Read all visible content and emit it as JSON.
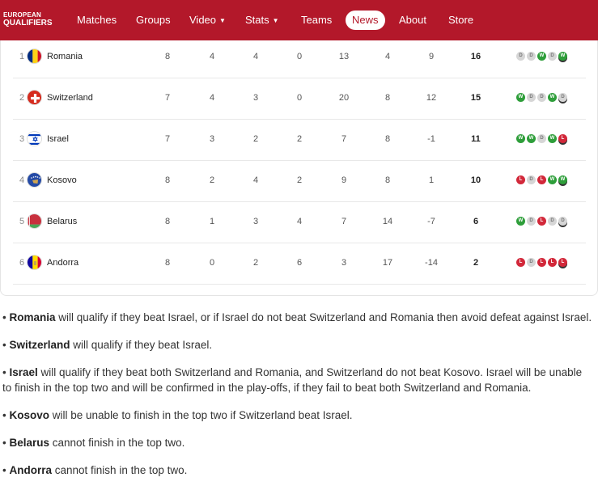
{
  "nav": {
    "logo_line1": "EUROPEAN",
    "logo_line2": "QUALIFIERS",
    "items": [
      {
        "label": "Matches"
      },
      {
        "label": "Groups"
      },
      {
        "label": "Video",
        "caret": "▼"
      },
      {
        "label": "Stats",
        "caret": "▼"
      },
      {
        "label": "Teams"
      },
      {
        "label": "News",
        "active": true
      },
      {
        "label": "About"
      },
      {
        "label": "Store"
      }
    ]
  },
  "standings": [
    {
      "pos": "1",
      "team": "Romania",
      "flag": "flag-romania-icon",
      "p": "8",
      "w": "4",
      "d": "4",
      "l": "0",
      "gf": "13",
      "ga": "4",
      "gd": "9",
      "pts": "16",
      "form": [
        "D",
        "D",
        "W",
        "D",
        "W"
      ]
    },
    {
      "pos": "2",
      "team": "Switzerland",
      "flag": "flag-switzerland-icon",
      "p": "7",
      "w": "4",
      "d": "3",
      "l": "0",
      "gf": "20",
      "ga": "8",
      "gd": "12",
      "pts": "15",
      "form": [
        "W",
        "D",
        "D",
        "W",
        "D"
      ]
    },
    {
      "pos": "3",
      "team": "Israel",
      "flag": "flag-israel-icon",
      "p": "7",
      "w": "3",
      "d": "2",
      "l": "2",
      "gf": "7",
      "ga": "8",
      "gd": "-1",
      "pts": "11",
      "form": [
        "W",
        "W",
        "D",
        "W",
        "L"
      ]
    },
    {
      "pos": "4",
      "team": "Kosovo",
      "flag": "flag-kosovo-icon",
      "p": "8",
      "w": "2",
      "d": "4",
      "l": "2",
      "gf": "9",
      "ga": "8",
      "gd": "1",
      "pts": "10",
      "form": [
        "L",
        "D",
        "L",
        "W",
        "W"
      ]
    },
    {
      "pos": "5",
      "team": "Belarus",
      "flag": "flag-belarus-icon",
      "p": "8",
      "w": "1",
      "d": "3",
      "l": "4",
      "gf": "7",
      "ga": "14",
      "gd": "-7",
      "pts": "6",
      "form": [
        "W",
        "D",
        "L",
        "D",
        "D"
      ]
    },
    {
      "pos": "6",
      "team": "Andorra",
      "flag": "flag-andorra-icon",
      "p": "8",
      "w": "0",
      "d": "2",
      "l": "6",
      "gf": "3",
      "ga": "17",
      "gd": "-14",
      "pts": "2",
      "form": [
        "L",
        "D",
        "L",
        "L",
        "L"
      ]
    }
  ],
  "notes": [
    {
      "team": "Romania",
      "text": "will qualify if they beat Israel, or if Israel do not beat Switzerland and Romania then avoid defeat against Israel."
    },
    {
      "team": "Switzerland",
      "text": "will qualify if they beat Israel."
    },
    {
      "team": "Israel",
      "text": "will qualify if they beat both Switzerland and Romania, and Switzerland do not beat Kosovo. Israel will be unable to finish in the top two and will be confirmed in the play-offs, if they fail to beat both Switzerland and Romania."
    },
    {
      "team": "Kosovo",
      "text": "will be unable to finish in the top two if Switzerland beat Israel."
    },
    {
      "team": "Belarus",
      "text": "cannot finish in the top two."
    },
    {
      "team": "Andorra",
      "text": "cannot finish in the top two."
    }
  ],
  "colors": {
    "brand": "#b3182a",
    "win": "#2e9e3a",
    "draw": "#d6d6d6",
    "loss": "#d2283a"
  }
}
